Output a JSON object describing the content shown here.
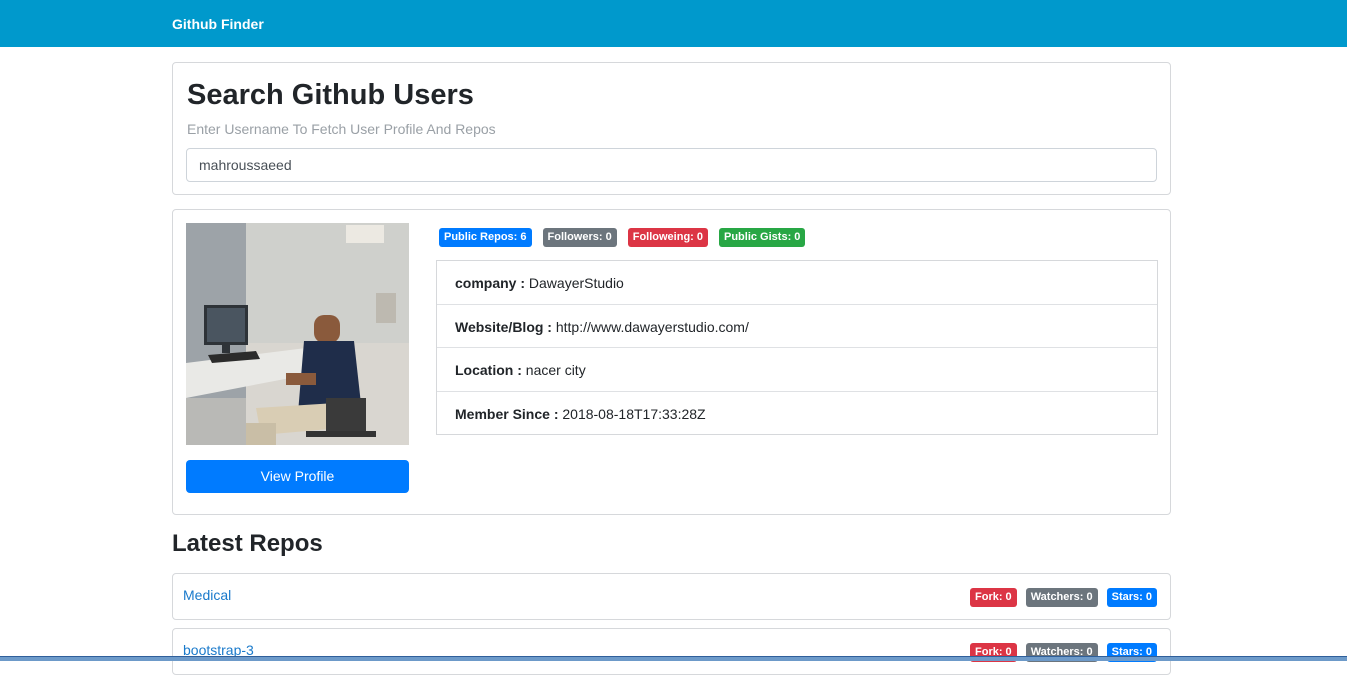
{
  "navbar": {
    "brand": "Github Finder"
  },
  "search": {
    "title": "Search Github Users",
    "lead": "Enter Username To Fetch User Profile And Repos",
    "value": "mahroussaeed"
  },
  "profile": {
    "view_button": "View Profile",
    "badges": {
      "public_repos": "Public Repos: 6",
      "followers": "Followers: 0",
      "following": "Followeing: 0",
      "public_gists": "Public Gists: 0"
    },
    "details": [
      {
        "label": "company :",
        "value": "DawayerStudio"
      },
      {
        "label": "Website/Blog :",
        "value": "http://www.dawayerstudio.com/"
      },
      {
        "label": "Location :",
        "value": "nacer city"
      },
      {
        "label": "Member Since :",
        "value": "2018-08-18T17:33:28Z"
      }
    ]
  },
  "repos": {
    "title": "Latest Repos",
    "items": [
      {
        "name": "Medical",
        "fork": "Fork: 0",
        "watchers": "Watchers: 0",
        "stars": "Stars: 0"
      },
      {
        "name": "bootstrap-3",
        "fork": "Fork: 0",
        "watchers": "Watchers: 0",
        "stars": "Stars: 0"
      }
    ]
  },
  "colors": {
    "navbar": "#0099cc",
    "primary": "#007bff",
    "secondary": "#6c757d",
    "danger": "#dc3545",
    "success": "#28a745",
    "link": "#1a7acb"
  }
}
